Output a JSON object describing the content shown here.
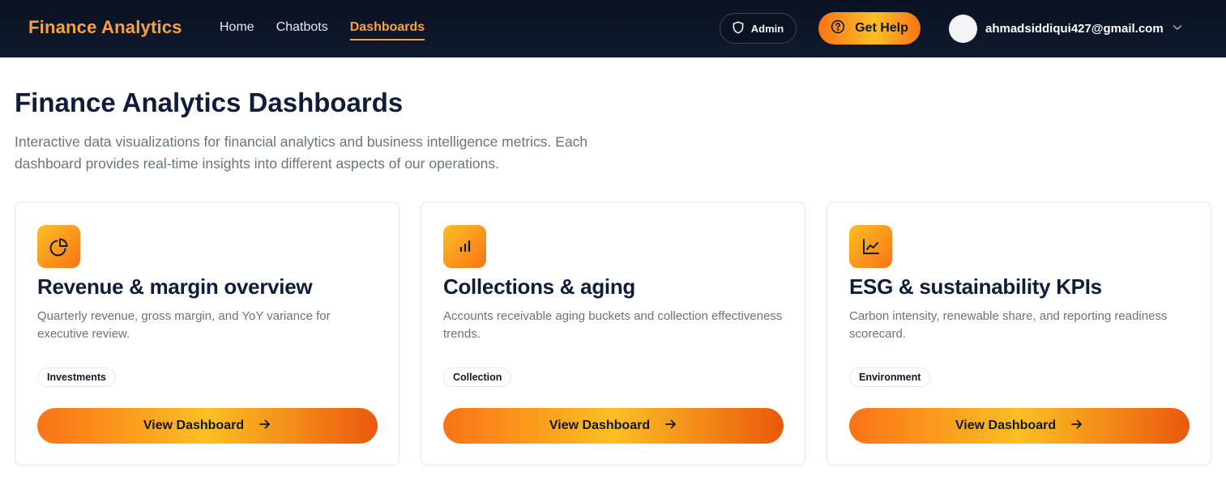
{
  "header": {
    "brand": "Finance Analytics",
    "nav": [
      {
        "label": "Home"
      },
      {
        "label": "Chatbots"
      },
      {
        "label": "Dashboards",
        "active": true
      }
    ],
    "admin_label": "Admin",
    "help_label": "Get Help",
    "user_email": "ahmadsiddiqui427@gmail.com"
  },
  "page": {
    "title": "Finance Analytics Dashboards",
    "description": "Interactive data visualizations for financial analytics and business intelligence metrics. Each dashboard provides real-time insights into different aspects of our operations."
  },
  "cards": [
    {
      "icon": "pie-chart-icon",
      "title": "Revenue & margin overview",
      "description": "Quarterly revenue, gross margin, and YoY variance for executive review.",
      "tag": "Investments",
      "button_label": "View Dashboard"
    },
    {
      "icon": "bar-chart-icon",
      "title": "Collections & aging",
      "description": "Accounts receivable aging buckets and collection effectiveness trends.",
      "tag": "Collection",
      "button_label": "View Dashboard"
    },
    {
      "icon": "line-chart-icon",
      "title": "ESG & sustainability KPIs",
      "description": "Carbon intensity, renewable share, and reporting readiness scorecard.",
      "tag": "Environment",
      "button_label": "View Dashboard"
    }
  ],
  "colors": {
    "navbar_bg": "#0a1222",
    "accent": "#f7a23a",
    "title": "#0f1d3d",
    "muted": "#6b7280"
  }
}
